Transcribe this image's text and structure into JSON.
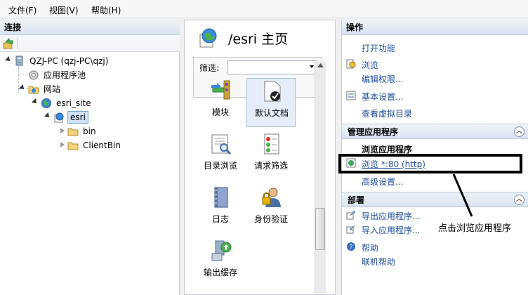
{
  "menu": {
    "file": "文件(F)",
    "view": "视图(V)",
    "help": "帮助(H)"
  },
  "connections": {
    "title": "连接",
    "tree": {
      "server": "QZJ-PC (qzj-PC\\qzj)",
      "app_pools": "应用程序池",
      "sites": "网站",
      "site": "esri_site",
      "app": "esri",
      "folder1": "bin",
      "folder2": "ClientBin"
    }
  },
  "home": {
    "title": "/esri 主页",
    "filter_label": "筛选:",
    "features": {
      "modules": "模块",
      "default_doc": "默认文档",
      "dir_browse": "目录浏览",
      "req_filter": "请求筛选",
      "logging": "日志",
      "auth": "身份验证",
      "output_cache": "输出缓存"
    }
  },
  "actions": {
    "title": "操作",
    "open_feature": "打开功能",
    "browse": "浏览",
    "edit_perms": "编辑权限...",
    "basic_settings": "基本设置...",
    "view_vdirs": "查看虚拟目录",
    "manage_app": {
      "title": "管理应用程序",
      "browse_app": "浏览应用程序",
      "browse_80": "浏览 *:80 (http)",
      "advanced": "高级设置..."
    },
    "deploy": {
      "title": "部署",
      "export_app": "导出应用程序...",
      "import_app": "导入应用程序..."
    },
    "help": "帮助",
    "online_help": "联机帮助"
  },
  "annotation": "点击浏览应用程序",
  "colors": {
    "link": "#1f4d9a",
    "header_bg": "#d9e4f1",
    "annotation_box": "#000000"
  }
}
